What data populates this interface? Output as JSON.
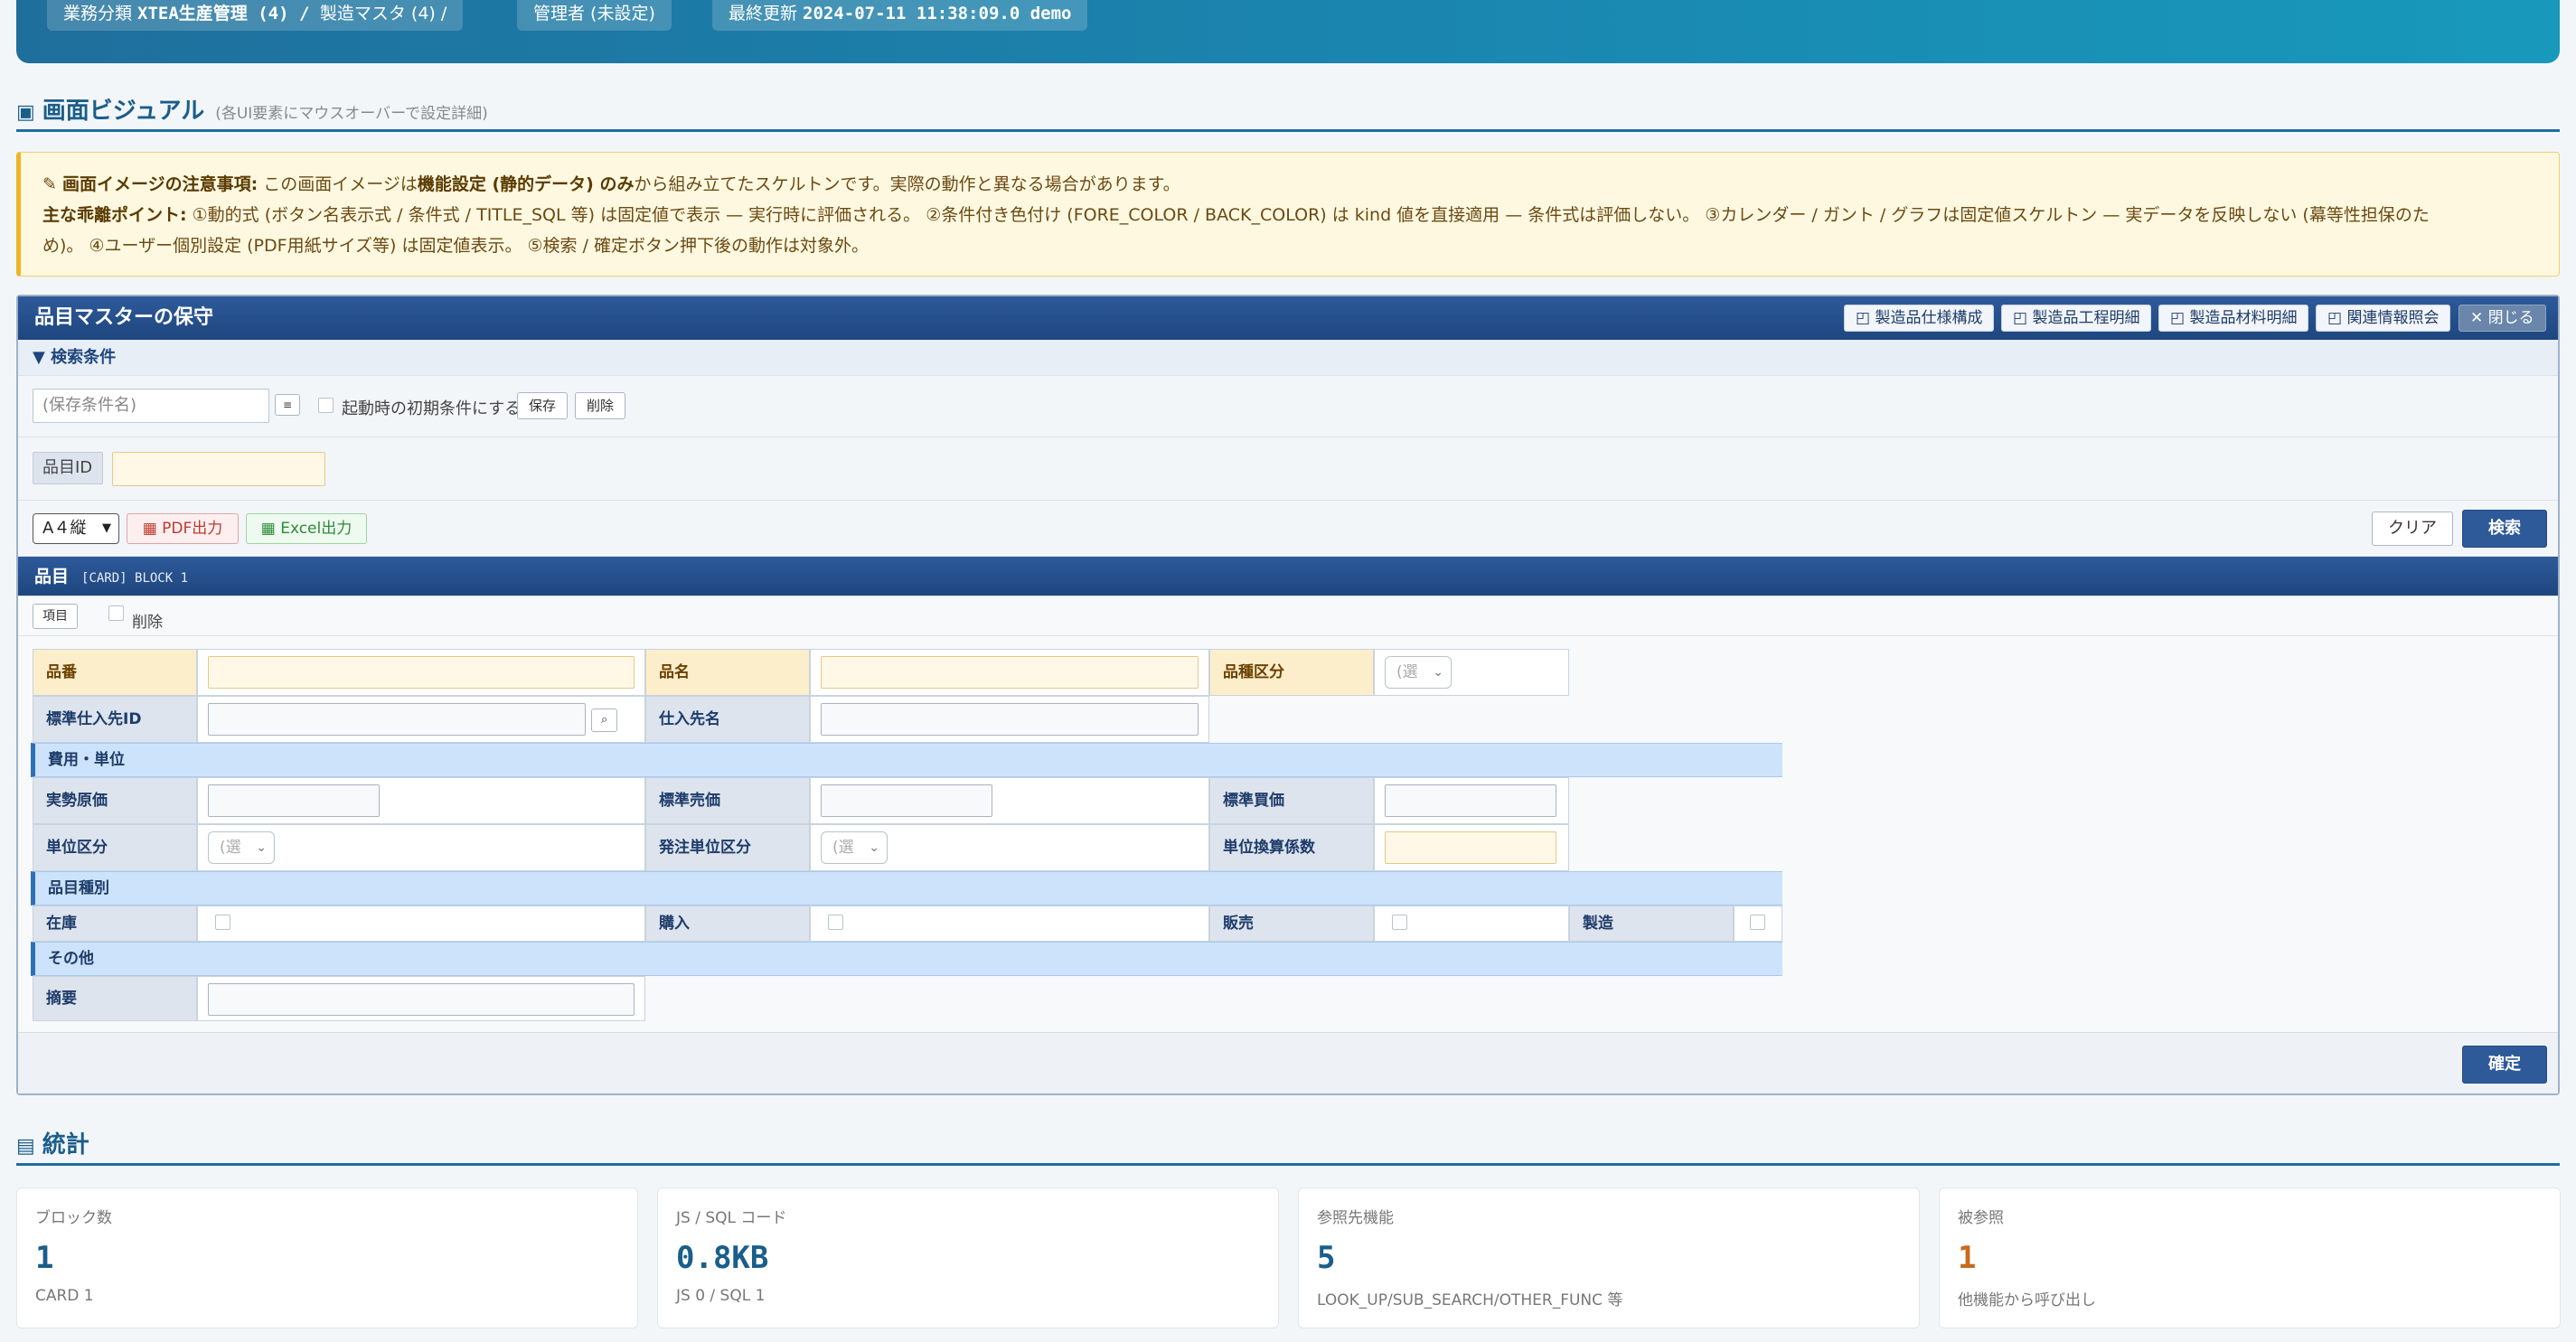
{
  "header": {
    "chips": [
      {
        "prefix": "業務分類 ",
        "strong": "XTEA生産管理 (4) / ",
        "suffix": "製造マスタ (4) /"
      },
      {
        "prefix": "管理者 (未設定)",
        "strong": "",
        "suffix": ""
      },
      {
        "prefix": "最終更新 ",
        "strong": "2024-07-11 11:38:09.0 demo",
        "suffix": ""
      }
    ]
  },
  "visual_section": {
    "title": "画面ビジュアル",
    "subtitle": "(各UI要素にマウスオーバーで設定詳細)"
  },
  "notice": {
    "line1_label": "画面イメージの注意事項:",
    "line1_text_a": " この画面イメージは",
    "line1_strong": "機能設定 (静的データ) のみ",
    "line1_text_b": "から組み立てたスケルトンです。実際の動作と異なる場合があります。",
    "line2_label": "主な乖離ポイント:",
    "line2_text": " ①動的式 (ボタン名表示式 / 条件式 / TITLE_SQL 等) は固定値で表示 — 実行時に評価される。 ②条件付き色付け (FORE_COLOR / BACK_COLOR) は kind 値を直接適用 — 条件式は評価しない。 ③カレンダー / ガント / グラフは固定値スケルトン — 実データを反映しない (幕等性担保のた",
    "line3_text": "め)。 ④ユーザー個別設定 (PDF用紙サイズ等) は固定値表示。 ⑤検索 / 確定ボタン押下後の動作は対象外。"
  },
  "window": {
    "title": "品目マスターの保守",
    "toolbar": [
      "製造品仕様構成",
      "製造品工程明細",
      "製造品材料明細",
      "関連情報照会"
    ],
    "close_label": "閉じる",
    "search_toggle": "▼ 検索条件",
    "saved_condition_placeholder": "(保存条件名)",
    "menu_glyph": "≡",
    "default_condition_label": "起動時の初期条件にする",
    "save_label": "保存",
    "delete_label": "削除",
    "item_id_label": "品目ID",
    "paper_size": "A４縦",
    "pdf_label": "PDF出力",
    "excel_label": "Excel出力",
    "clear_label": "クリア",
    "search_label": "検索",
    "block_title": "品目",
    "block_sub": "[CARD] BLOCK 1",
    "item_button": "項目",
    "block_delete_label": "削除",
    "confirm_label": "確定"
  },
  "form": {
    "hinban": "品番",
    "hinmei": "品名",
    "hinshu_kubun": "品種区分",
    "select_placeholder": "(選",
    "std_supplier_id": "標準仕入先ID",
    "lookup_glyph": "⌕",
    "supplier_name": "仕入先名",
    "group_cost": "費用・単位",
    "actual_cost": "実勢原価",
    "std_sell": "標準売価",
    "std_buy": "標準買価",
    "unit_kubun": "単位区分",
    "order_unit_kubun": "発注単位区分",
    "unit_factor": "単位換算係数",
    "group_type": "品目種別",
    "stock": "在庫",
    "purchase": "購入",
    "sales": "販売",
    "manufacture": "製造",
    "group_other": "その他",
    "summary": "摘要"
  },
  "stats": {
    "title": "統計",
    "cards": [
      {
        "key": "ブロック数",
        "value": "1",
        "desc": "CARD 1"
      },
      {
        "key": "JS / SQL コード",
        "value": "0.8KB",
        "desc": "JS 0 / SQL 1"
      },
      {
        "key": "参照先機能",
        "value": "5",
        "desc": "LOOK_UP/SUB_SEARCH/OTHER_FUNC 等"
      },
      {
        "key": "被参照",
        "value": "1",
        "desc": "他機能から呼び出し"
      }
    ]
  },
  "colors": {
    "accent": "#1f6f9c",
    "window_title": "#2e5a9a",
    "required_label": "#fdeecb",
    "notice_bg": "#fff8e1",
    "stat_orange": "#c96a1e"
  }
}
